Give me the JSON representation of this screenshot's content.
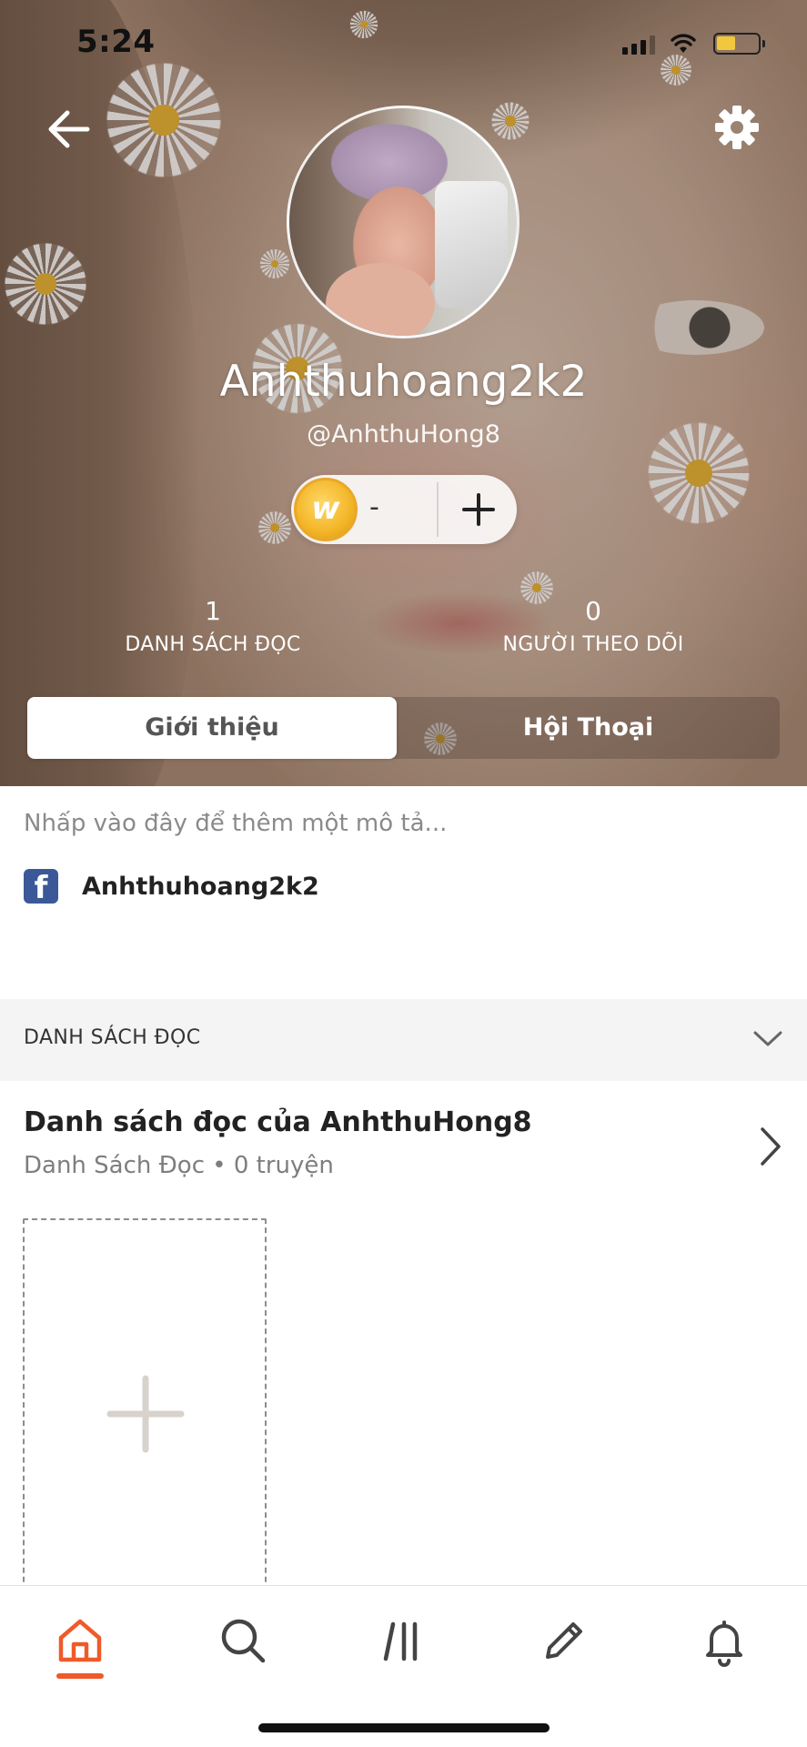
{
  "status_bar": {
    "time": "5:24"
  },
  "profile": {
    "display_name": "Anhthuhoang2k2",
    "handle": "@AnhthuHong8",
    "coins": "-",
    "stats": [
      {
        "value": "1",
        "label": "DANH SÁCH ĐỌC"
      },
      {
        "value": "0",
        "label": "NGƯỜI THEO DÕI"
      }
    ]
  },
  "tabs": [
    {
      "label": "Giới thiệu",
      "active": true
    },
    {
      "label": "Hội Thoại",
      "active": false
    }
  ],
  "about": {
    "description_placeholder": "Nhấp vào đây để thêm một mô tả...",
    "facebook_name": "Anhthuhoang2k2"
  },
  "reading_lists_section": {
    "title": "DANH SÁCH ĐỌC",
    "list": {
      "title": "Danh sách đọc của AnhthuHong8",
      "subtitle": "Danh Sách Đọc • 0 truyện"
    }
  },
  "bottom_nav": {
    "items": [
      {
        "icon": "home-icon",
        "active": true
      },
      {
        "icon": "search-icon",
        "active": false
      },
      {
        "icon": "library-icon",
        "active": false
      },
      {
        "icon": "pencil-icon",
        "active": false
      },
      {
        "icon": "bell-icon",
        "active": false
      }
    ]
  },
  "colors": {
    "accent": "#ef5a2a",
    "facebook": "#3b5998",
    "coin": "#f3b526"
  }
}
